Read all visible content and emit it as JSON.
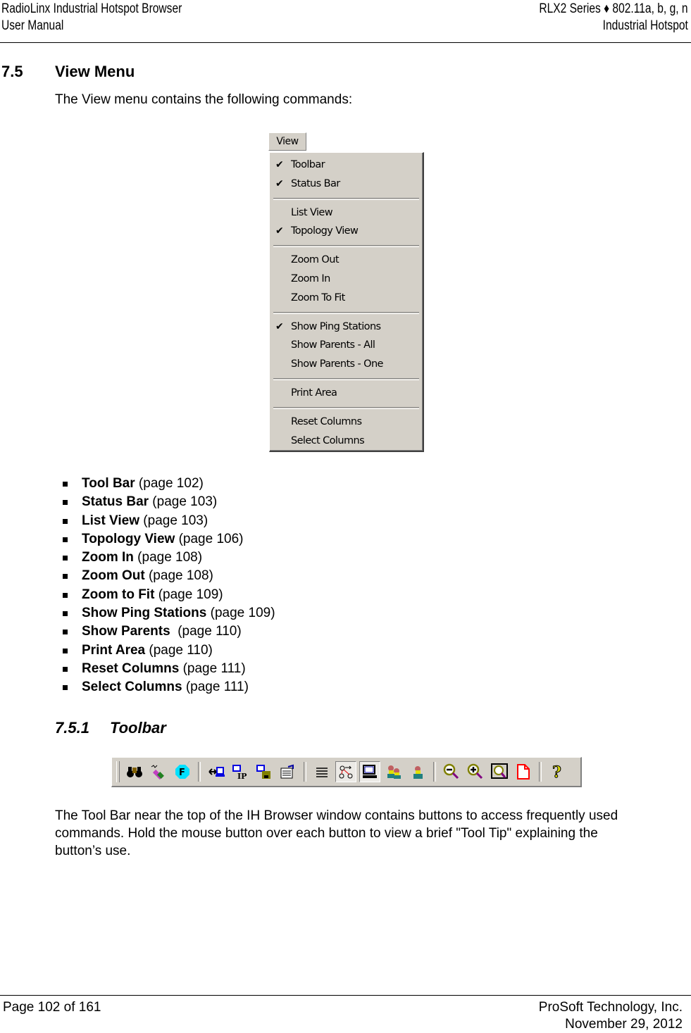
{
  "header": {
    "left_line1": "RadioLinx Industrial Hotspot Browser",
    "left_line2": "User Manual",
    "right_line1": "RLX2 Series ♦ 802.11a, b, g, n",
    "right_line2": "Industrial Hotspot"
  },
  "section": {
    "number": "7.5",
    "title": "View Menu",
    "intro": "The View menu contains the following commands:"
  },
  "view_menu": {
    "button_label": "View",
    "check_glyph": "✔",
    "groups": [
      [
        {
          "label": "Toolbar",
          "checked": true
        },
        {
          "label": "Status Bar",
          "checked": true
        }
      ],
      [
        {
          "label": "List View",
          "checked": false
        },
        {
          "label": "Topology View",
          "checked": true
        }
      ],
      [
        {
          "label": "Zoom Out",
          "checked": false
        },
        {
          "label": "Zoom In",
          "checked": false
        },
        {
          "label": "Zoom To Fit",
          "checked": false
        }
      ],
      [
        {
          "label": "Show Ping Stations",
          "checked": true
        },
        {
          "label": "Show Parents - All",
          "checked": false
        },
        {
          "label": "Show Parents - One",
          "checked": false
        }
      ],
      [
        {
          "label": "Print Area",
          "checked": false
        }
      ],
      [
        {
          "label": "Reset Columns",
          "checked": false
        },
        {
          "label": "Select Columns",
          "checked": false
        }
      ]
    ]
  },
  "commands": [
    {
      "name": "Tool Bar",
      "ref": " (page 102)"
    },
    {
      "name": "Status Bar",
      "ref": " (page 103)"
    },
    {
      "name": "List View",
      "ref": " (page 103)"
    },
    {
      "name": "Topology View",
      "ref": " (page 106)"
    },
    {
      "name": "Zoom In",
      "ref": " (page 108)"
    },
    {
      "name": "Zoom Out",
      "ref": " (page 108)"
    },
    {
      "name": "Zoom to Fit",
      "ref": " (page 109)"
    },
    {
      "name": "Show Ping Stations",
      "ref": " (page 109)"
    },
    {
      "name": "Show Parents ",
      "ref": " (page 110)"
    },
    {
      "name": "Print Area",
      "ref": " (page 110)"
    },
    {
      "name": "Reset Columns",
      "ref": " (page 111)"
    },
    {
      "name": "Select Columns",
      "ref": " (page 111)"
    }
  ],
  "subsection": {
    "number": "7.5.1",
    "title": "Toolbar",
    "toolbar_icons": [
      "binoculars-icon",
      "wireless-probe-icon",
      "f-octagon-icon",
      "separator",
      "connect-computer-icon",
      "computer-ip-icon",
      "computer-save-icon",
      "properties-icon",
      "separator",
      "list-view-icon",
      "topology-view-icon",
      "computer-view-icon",
      "show-parents-all-icon",
      "show-parents-one-icon",
      "separator",
      "zoom-out-icon",
      "zoom-in-icon",
      "zoom-to-fit-icon",
      "print-area-icon",
      "separator",
      "help-icon"
    ],
    "pressed_icons": [
      "topology-view-icon",
      "computer-view-icon"
    ],
    "body": "The Tool Bar near the top of the IH Browser window contains buttons to access frequently used commands. Hold the mouse button over each button to view a brief \"Tool Tip\" explaining the button’s use."
  },
  "footer": {
    "page": "Page 102 of 161",
    "company": "ProSoft Technology, Inc.",
    "date": "November 29, 2012"
  }
}
